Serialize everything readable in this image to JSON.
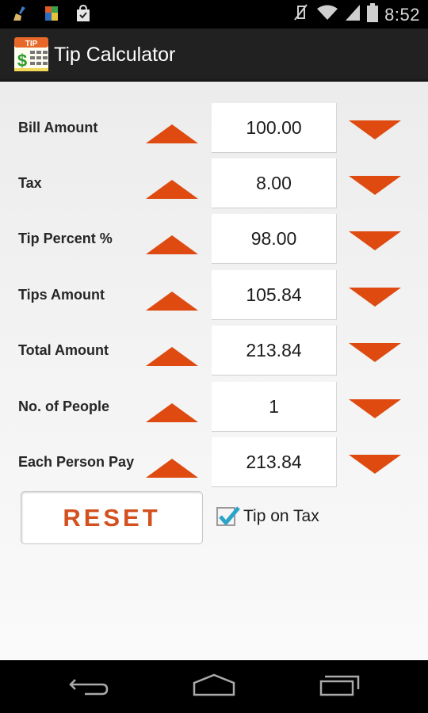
{
  "status_bar": {
    "notification_icons": [
      "cleaner-broom-icon",
      "antivirus-icon",
      "shopping-bag-check-icon"
    ],
    "system_icons": [
      "vibrate-off-icon",
      "wifi-icon",
      "signal-icon",
      "battery-icon"
    ],
    "time": "8:52"
  },
  "action_bar": {
    "app_icon_label": "TIP",
    "title": "Tip Calculator"
  },
  "rows": [
    {
      "label": "Bill Amount",
      "value": "100.00"
    },
    {
      "label": "Tax",
      "value": "8.00"
    },
    {
      "label": "Tip Percent %",
      "value": "98.00"
    },
    {
      "label": "Tips Amount",
      "value": "105.84"
    },
    {
      "label": "Total Amount",
      "value": "213.84"
    },
    {
      "label": "No. of People",
      "value": "1"
    },
    {
      "label": "Each Person Pay",
      "value": "213.84"
    }
  ],
  "reset_button": {
    "label": "RESET"
  },
  "tip_on_tax": {
    "label": "Tip on Tax",
    "checked": true
  },
  "colors": {
    "accent_orange": "#de4a10",
    "reset_text": "#d3501f",
    "checkbox_check": "#2aa5c9"
  },
  "nav_bar": {
    "buttons": [
      "back-icon",
      "home-icon",
      "recent-apps-icon"
    ]
  }
}
